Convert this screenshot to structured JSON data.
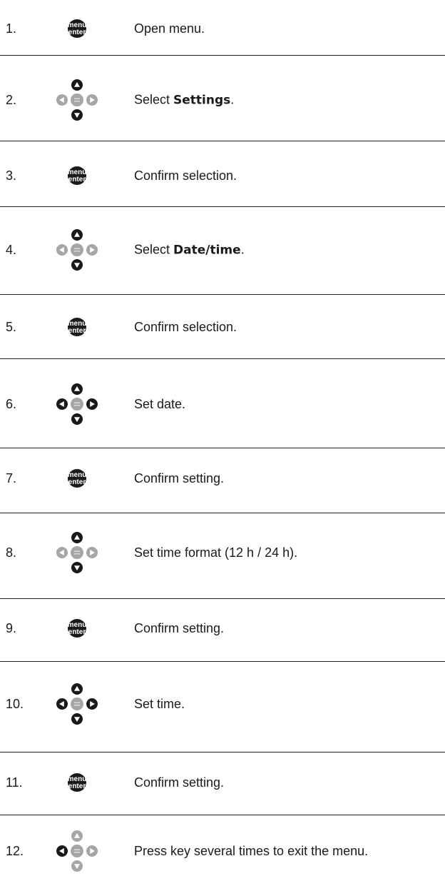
{
  "steps": [
    {
      "number": "1.",
      "icon": "menu-enter-button",
      "text_before": "Open menu.",
      "bold": "",
      "text_after": ""
    },
    {
      "number": "2.",
      "icon": "dpad-up-down-active",
      "text_before": "Select ",
      "bold": "Settings",
      "text_after": "."
    },
    {
      "number": "3.",
      "icon": "menu-enter-button",
      "text_before": "Confirm selection.",
      "bold": "",
      "text_after": ""
    },
    {
      "number": "4.",
      "icon": "dpad-up-down-active",
      "text_before": "Select ",
      "bold": "Date/time",
      "text_after": "."
    },
    {
      "number": "5.",
      "icon": "menu-enter-button",
      "text_before": "Confirm selection.",
      "bold": "",
      "text_after": ""
    },
    {
      "number": "6.",
      "icon": "dpad-all-arrows-active",
      "text_before": "Set date.",
      "bold": "",
      "text_after": ""
    },
    {
      "number": "7.",
      "icon": "menu-enter-button",
      "text_before": "Confirm setting.",
      "bold": "",
      "text_after": ""
    },
    {
      "number": "8.",
      "icon": "dpad-up-down-active",
      "text_before": "Set time format (12 h / 24 h).",
      "bold": "",
      "text_after": ""
    },
    {
      "number": "9.",
      "icon": "menu-enter-button",
      "text_before": "Confirm setting.",
      "bold": "",
      "text_after": ""
    },
    {
      "number": "10.",
      "icon": "dpad-all-arrows-active",
      "text_before": "Set time.",
      "bold": "",
      "text_after": ""
    },
    {
      "number": "11.",
      "icon": "menu-enter-button",
      "text_before": "Confirm setting.",
      "bold": "",
      "text_after": ""
    },
    {
      "number": "12.",
      "icon": "dpad-left-active",
      "text_before": "Press key several times to exit the menu.",
      "bold": "",
      "text_after": ""
    }
  ],
  "button_label": {
    "line1": "menu",
    "line2": "enter"
  },
  "colors": {
    "active": "#1a1a1a",
    "inactive": "#a6a6a6",
    "separator": "#222222"
  }
}
